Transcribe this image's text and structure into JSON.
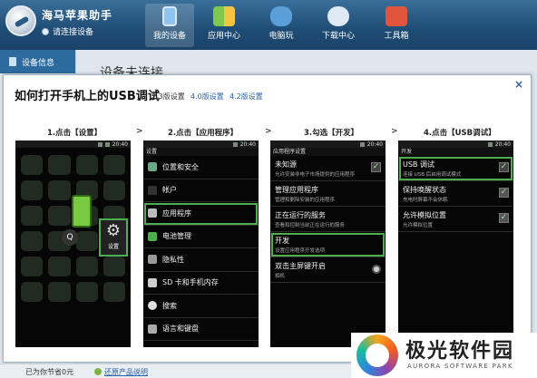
{
  "app": {
    "name": "海马苹果助手",
    "connect_status": "请连接设备"
  },
  "nav": [
    {
      "label": "我的设备",
      "icon": "phone-icon",
      "color": "#8fc3f0",
      "active": true
    },
    {
      "label": "应用中心",
      "icon": "apps-icon",
      "color": "#7ec850"
    },
    {
      "label": "电脑玩",
      "icon": "gamepad-icon",
      "color": "#5a9fd8"
    },
    {
      "label": "下载中心",
      "icon": "cloud-download-icon",
      "color": "#dfe9f3"
    },
    {
      "label": "工具箱",
      "icon": "toolbox-icon",
      "color": "#e0553b"
    }
  ],
  "sidebar": {
    "item": "设备信息"
  },
  "background": {
    "title": "设备未连接"
  },
  "dialog": {
    "title": "如何打开手机上的USB调试",
    "versions": [
      "2.3版设置",
      "4.0版设置",
      "4.2版设置"
    ],
    "close": "×",
    "arrow": ">",
    "steps": [
      "1.点击【设置】",
      "2.点击【应用程序】",
      "3.勾选【开发】",
      "4.点击【USB调试】"
    ],
    "status_time": "20:40",
    "phone1": {
      "settings_label": "设置",
      "search": "Q"
    },
    "phone2": {
      "title": "设置",
      "items": [
        "位置和安全",
        "帐户",
        "应用程序",
        "电池管理",
        "隐私性",
        "SD 卡和手机内存",
        "搜索",
        "语言和键盘"
      ]
    },
    "phone3": {
      "title": "应用程序设置",
      "items": [
        {
          "t": "未知源",
          "d": "允许安装非电子市场提供的应用程序"
        },
        {
          "t": "管理应用程序",
          "d": "管理和删除安装的应用程序"
        },
        {
          "t": "正在运行的服务",
          "d": "查看和控制当前正在运行的服务"
        },
        {
          "t": "开发",
          "d": "设置应用程序开发选项"
        },
        {
          "t": "双击主屏键开启",
          "d": "相机"
        }
      ]
    },
    "phone4": {
      "title": "开发",
      "items": [
        {
          "t": "USB 调试",
          "d": "连接 USB 后启用调试模式"
        },
        {
          "t": "保持唤醒状态",
          "d": "充电时屏幕不会休眠"
        },
        {
          "t": "允许模拟位置",
          "d": "允许模拟位置"
        }
      ]
    }
  },
  "statusbar": {
    "left": "已为你节省0元",
    "link": "还原产品说明"
  },
  "watermark": {
    "cn": "极光软件园",
    "en": "AURORA SOFTWARE PARK"
  },
  "colors": {
    "highlight": "#4caf50",
    "link": "#2b5fa6",
    "header": "#1f4c74"
  }
}
